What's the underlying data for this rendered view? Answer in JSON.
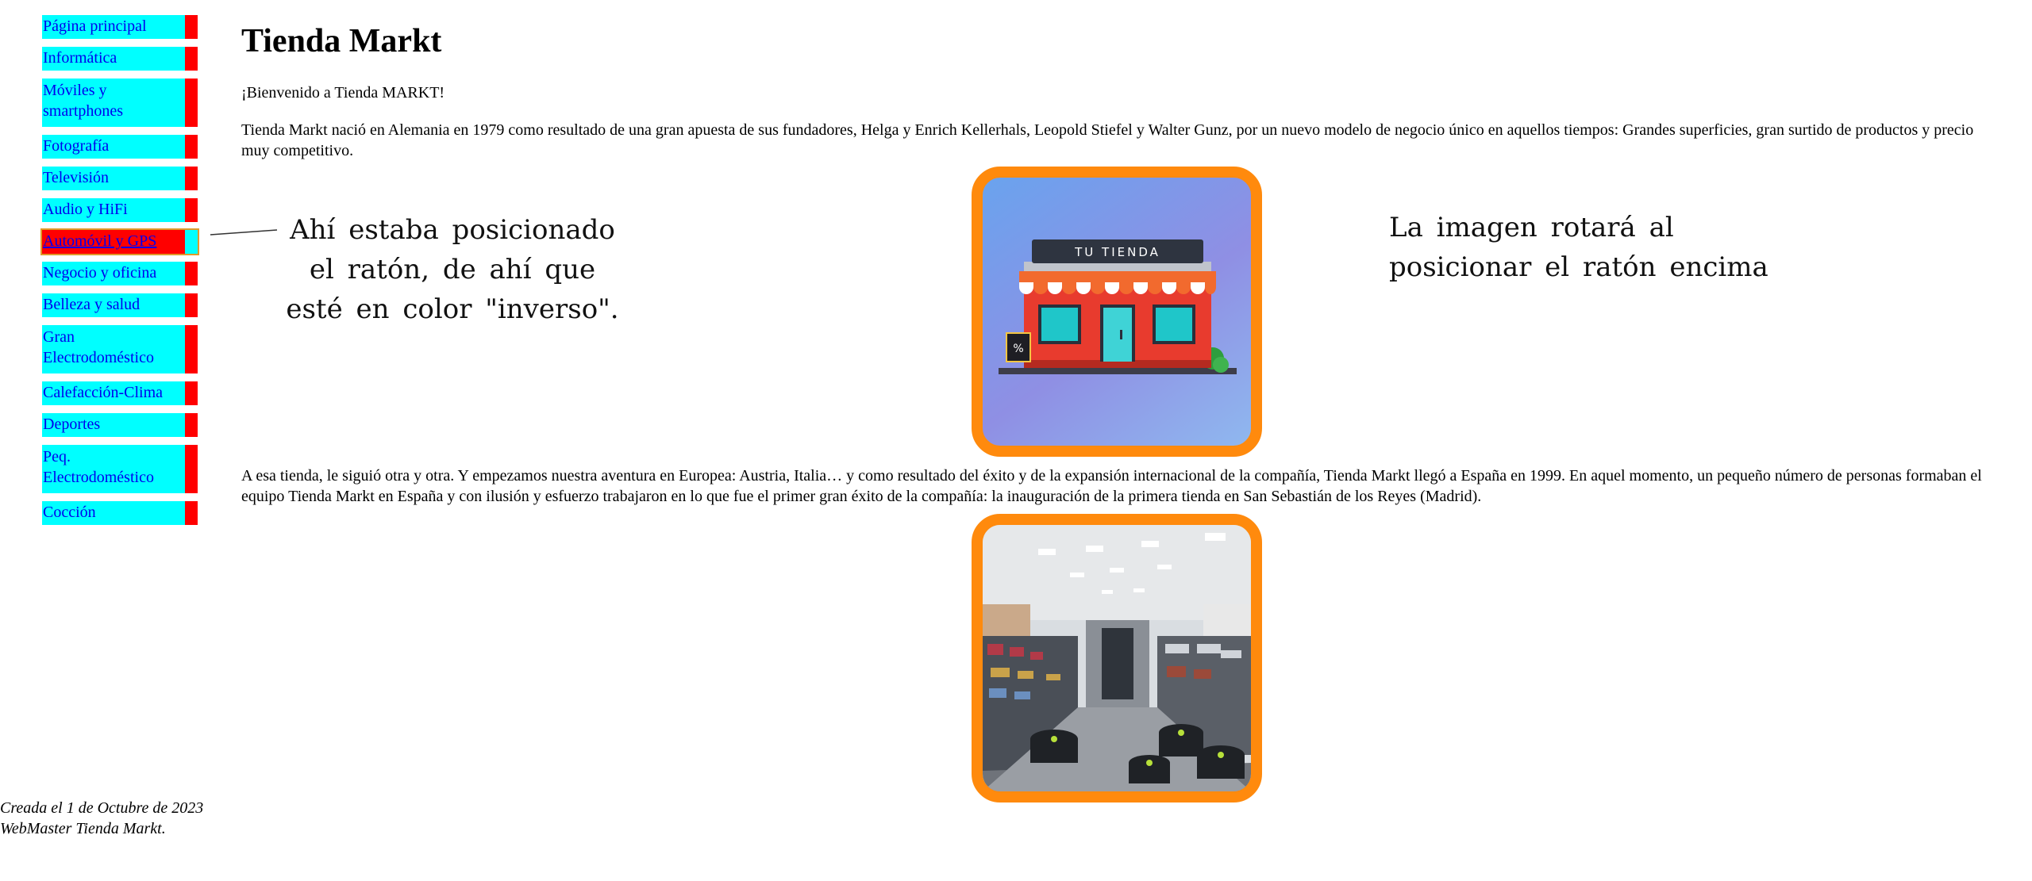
{
  "nav": {
    "items": [
      {
        "label": "Página principal"
      },
      {
        "label": "Informática"
      },
      {
        "label": "Móviles y smartphones"
      },
      {
        "label": "Fotografía"
      },
      {
        "label": "Televisión"
      },
      {
        "label": "Audio y HiFi"
      },
      {
        "label": "Automóvil y GPS"
      },
      {
        "label": "Negocio y oficina"
      },
      {
        "label": "Belleza y salud"
      },
      {
        "label": "Gran Electrodoméstico"
      },
      {
        "label": "Calefacción-Clima"
      },
      {
        "label": "Deportes"
      },
      {
        "label": "Peq. Electrodoméstico"
      },
      {
        "label": "Cocción"
      }
    ],
    "colors": {
      "background": "#00ffff",
      "accent": "#ff0000",
      "link": "#0000ee"
    }
  },
  "main": {
    "title": "Tienda Markt",
    "welcome": "¡Bienvenido a Tienda MARKT!",
    "history": "Tienda Markt nació en Alemania en 1979 como resultado de una gran apuesta de sus fundadores, Helga y Enrich Kellerhals, Leopold Stiefel y Walter Gunz, por un nuevo modelo de negocio único en aquellos tiempos: Grandes superficies, gran surtido de productos y precio muy competitivo.",
    "expansion": "A esa tienda, le siguió otra y otra. Y empezamos nuestra aventura en Europea: Austria, Italia… y como resultado del éxito y de la expansión internacional de la compañía, Tienda Markt llegó a España en 1999. En aquel momento, un pequeño número de personas formaban el equipo Tienda Markt en España y con ilusión y esfuerzo trabajaron en lo que fue el primer gran éxito de la compañía: la inauguración de la primera tienda en San Sebastián de los Reyes (Madrid).",
    "store_image": {
      "sign": "TU TIENDA",
      "badge": "%"
    },
    "frame_color": "#ff8a0d"
  },
  "annotations": {
    "mouse_note": "Ahí estaba posicionado el ratón, de ahí que esté en color \"inverso\".",
    "rotate_note": "La imagen rotará al posicionar el ratón encima"
  },
  "footer": {
    "line1": "Creada el 1 de Octubre de 2023",
    "line2": "WebMaster Tienda Markt."
  }
}
